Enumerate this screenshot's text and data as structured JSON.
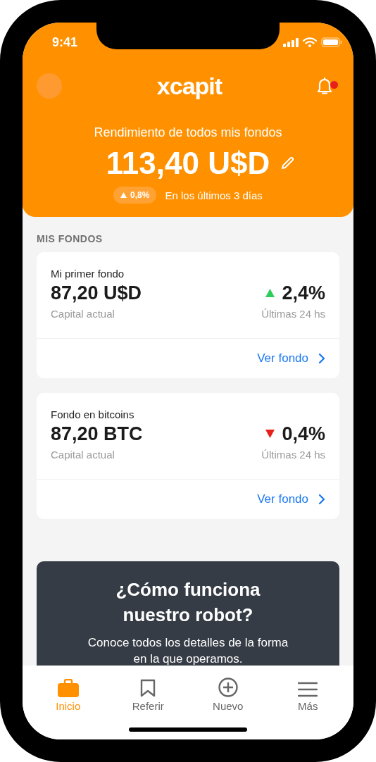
{
  "status_bar": {
    "time": "9:41"
  },
  "header": {
    "logo": "xcapit",
    "unread": true,
    "title": "Rendimiento de todos mis fondos",
    "amount": "113,40 U$D",
    "change": {
      "kind": "up",
      "text": "0,8%"
    },
    "period": "En los últimos 3 días"
  },
  "section_title": "MIS FONDOS",
  "funds": [
    {
      "name": "Mi primer fondo",
      "amount": "87,20 U$D",
      "amount_label": "Capital actual",
      "change": {
        "kind": "up",
        "text": "2,4%"
      },
      "change_label": "Últimas 24 hs",
      "link": "Ver fondo"
    },
    {
      "name": "Fondo en bitcoins",
      "amount": "87,20 BTC",
      "amount_label": "Capital actual",
      "change": {
        "kind": "down",
        "text": "0,4%"
      },
      "change_label": "Últimas 24 hs",
      "link": "Ver fondo"
    }
  ],
  "promo": {
    "title": "¿Cómo funciona nuestro robot?",
    "description": "Conoce todos los detalles de la forma en la que operamos."
  },
  "tabs": [
    {
      "label": "Inicio",
      "selected": true
    },
    {
      "label": "Referir",
      "selected": false
    },
    {
      "label": "Nuevo",
      "selected": false
    },
    {
      "label": "Más",
      "selected": false
    }
  ]
}
